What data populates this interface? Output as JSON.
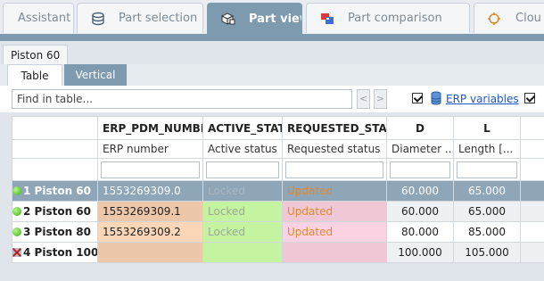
{
  "tabs": [
    {
      "label": "Assistant"
    },
    {
      "label": "Part selection"
    },
    {
      "label": "Part view"
    },
    {
      "label": "Part comparison"
    },
    {
      "label": "Clou"
    }
  ],
  "document_tab": "Piston 60",
  "view_tabs": {
    "table": "Table",
    "vertical": "Vertical"
  },
  "toolbar": {
    "search_placeholder": "Find in table...",
    "prev_symbol": "<",
    "next_symbol": ">",
    "erp_variables_label": "ERP variables"
  },
  "table": {
    "headers": [
      "ERP_PDM_NUMBER",
      "ACTIVE_STATE",
      "REQUESTED_STATE",
      "D",
      "L"
    ],
    "subheaders": [
      "ERP number",
      "Active status",
      "Requested status",
      "Diameter ...",
      "Length [..."
    ],
    "rows": [
      {
        "index": "1",
        "name": "Piston 60",
        "erp": "1553269309.0",
        "active": "Locked",
        "requested": "Updated",
        "d": "60.000",
        "l": "65.000"
      },
      {
        "index": "2",
        "name": "Piston 60",
        "erp": "1553269309.1",
        "active": "Locked",
        "requested": "Updated",
        "d": "60.000",
        "l": "65.000"
      },
      {
        "index": "3",
        "name": "Piston 80",
        "erp": "1553269309.2",
        "active": "Locked",
        "requested": "Updated",
        "d": "80.000",
        "l": "85.000"
      },
      {
        "index": "4",
        "name": "Piston 100",
        "erp": "",
        "active": "",
        "requested": "",
        "d": "100.000",
        "l": "105.000"
      }
    ]
  },
  "colors": {
    "accent": "#7e9aae",
    "selected_row": "#8ea6b8",
    "updated_text": "#e08a2c"
  }
}
